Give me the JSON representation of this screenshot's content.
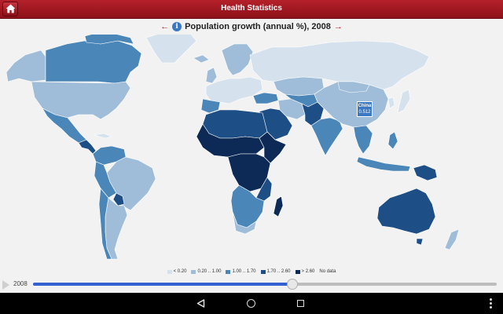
{
  "app": {
    "title": "Health Statistics"
  },
  "indicator": {
    "title": "Population growth (annual %), 2008",
    "info_glyph": "i",
    "prev_arrow": "←",
    "next_arrow": "→"
  },
  "tooltip": {
    "country": "China",
    "value": "0.512"
  },
  "legend": [
    {
      "label": "< 0.20",
      "color": "#d6e1ee"
    },
    {
      "label": "0.20 .. 1.00",
      "color": "#9fbdd9"
    },
    {
      "label": "1.00 .. 1.70",
      "color": "#4a86b8"
    },
    {
      "label": "1.70 .. 2.60",
      "color": "#1d4f86"
    },
    {
      "label": "> 2.60",
      "color": "#0c2a55"
    },
    {
      "label": "No data",
      "color": ""
    }
  ],
  "timeline": {
    "year": "2008",
    "progress": 0.56
  },
  "colors": {
    "ocean": "#f2f2f2",
    "border": "#ffffff",
    "accent": "#b5202a",
    "slider": "#3361d1"
  }
}
